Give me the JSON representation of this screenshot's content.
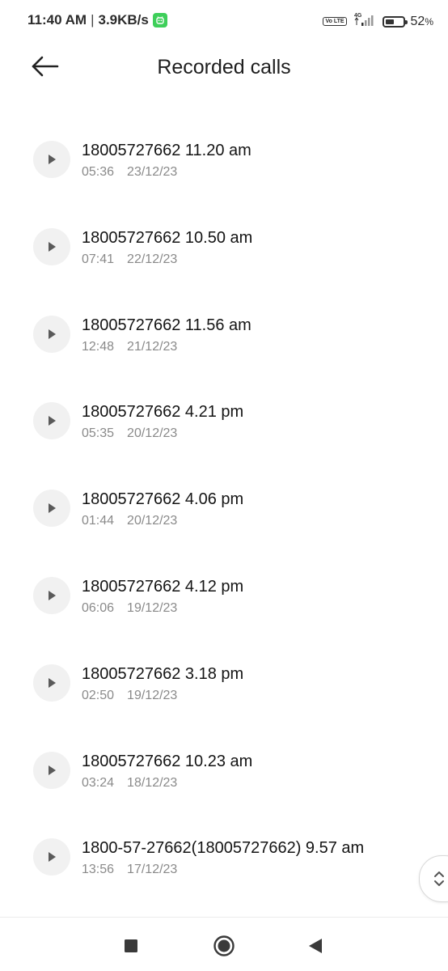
{
  "status_bar": {
    "time": "11:40 AM",
    "separator": "|",
    "net_speed": "3.9KB/s",
    "volte": "Vo LTE",
    "network": "4G",
    "battery_percent": "52",
    "battery_unit": "%",
    "battery_level": 0.52
  },
  "header": {
    "title": "Recorded calls",
    "back_icon": "arrow-left-icon"
  },
  "calls": [
    {
      "title": "18005727662 11.20 am",
      "duration": "05:36",
      "date": "23/12/23"
    },
    {
      "title": "18005727662 10.50 am",
      "duration": "07:41",
      "date": "22/12/23"
    },
    {
      "title": "18005727662 11.56 am",
      "duration": "12:48",
      "date": "21/12/23"
    },
    {
      "title": "18005727662 4.21 pm",
      "duration": "05:35",
      "date": "20/12/23"
    },
    {
      "title": "18005727662 4.06 pm",
      "duration": "01:44",
      "date": "20/12/23"
    },
    {
      "title": "18005727662 4.12 pm",
      "duration": "06:06",
      "date": "19/12/23"
    },
    {
      "title": "18005727662 3.18 pm",
      "duration": "02:50",
      "date": "19/12/23"
    },
    {
      "title": "18005727662 10.23 am",
      "duration": "03:24",
      "date": "18/12/23"
    },
    {
      "title": "1800-57-27662(18005727662) 9.57 am",
      "duration": "13:56",
      "date": "17/12/23"
    }
  ],
  "icons": {
    "play": "play-icon",
    "scroll_handle": "fast-scroll-icon",
    "nav_recents": "square-icon",
    "nav_home": "circle-icon",
    "nav_back": "triangle-back-icon"
  }
}
